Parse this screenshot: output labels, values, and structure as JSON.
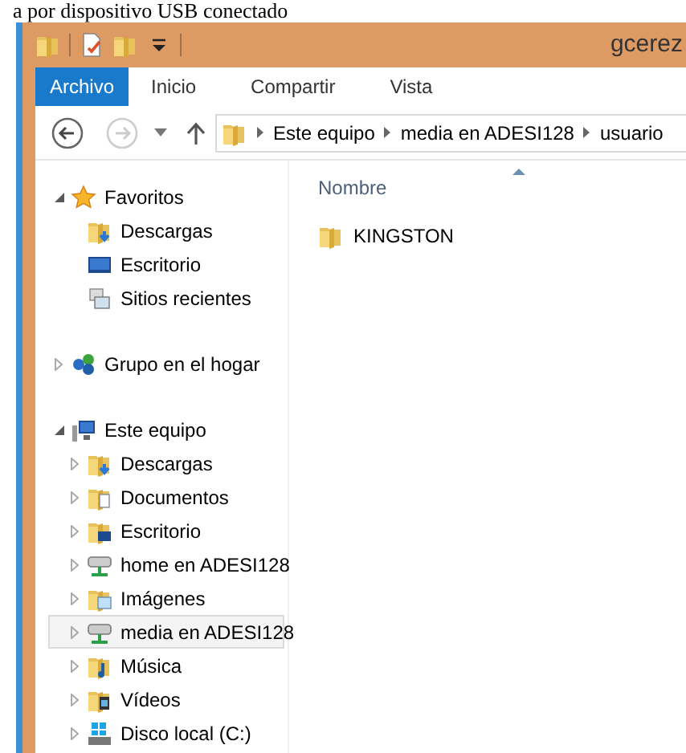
{
  "document_text": "a por dispositivo USB conectado",
  "window": {
    "title": "gcerez"
  },
  "quick_access": [
    {
      "kind": "folder"
    },
    {
      "kind": "properties"
    },
    {
      "kind": "new-folder"
    },
    {
      "kind": "customize"
    }
  ],
  "ribbon_tabs": [
    {
      "label": "Archivo",
      "selected": true
    },
    {
      "label": "Inicio",
      "selected": false
    },
    {
      "label": "Compartir",
      "selected": false
    },
    {
      "label": "Vista",
      "selected": false
    }
  ],
  "address": {
    "path": [
      "Este equipo",
      "media en ADESI128",
      "usuario"
    ]
  },
  "nav_tree": [
    {
      "label": "Favoritos",
      "kind": "star",
      "expanded": true,
      "selected": false,
      "children": [
        {
          "label": "Descargas",
          "kind": "downloads",
          "selected": false
        },
        {
          "label": "Escritorio",
          "kind": "desktop",
          "selected": false
        },
        {
          "label": "Sitios recientes",
          "kind": "recent",
          "selected": false
        }
      ]
    },
    {
      "label": "Grupo en el hogar",
      "kind": "homegroup",
      "expanded": false,
      "selected": false
    },
    {
      "label": "Este equipo",
      "kind": "computer",
      "expanded": true,
      "selected": false,
      "children": [
        {
          "label": "Descargas",
          "kind": "downloads",
          "expanded": false,
          "selected": false
        },
        {
          "label": "Documentos",
          "kind": "documents",
          "expanded": false,
          "selected": false
        },
        {
          "label": "Escritorio",
          "kind": "desktop-folder",
          "expanded": false,
          "selected": false
        },
        {
          "label": "home en ADESI128",
          "kind": "network-drive",
          "expanded": false,
          "selected": false
        },
        {
          "label": "Imágenes",
          "kind": "pictures",
          "expanded": false,
          "selected": false
        },
        {
          "label": "media en ADESI128",
          "kind": "network-drive",
          "expanded": false,
          "selected": true
        },
        {
          "label": "Música",
          "kind": "music",
          "expanded": false,
          "selected": false
        },
        {
          "label": "Vídeos",
          "kind": "videos",
          "expanded": false,
          "selected": false
        },
        {
          "label": "Disco local (C:)",
          "kind": "disk",
          "expanded": false,
          "selected": false
        }
      ]
    }
  ],
  "file_list": {
    "columns": [
      "Nombre"
    ],
    "items": [
      {
        "name": "KINGSTON"
      }
    ]
  }
}
